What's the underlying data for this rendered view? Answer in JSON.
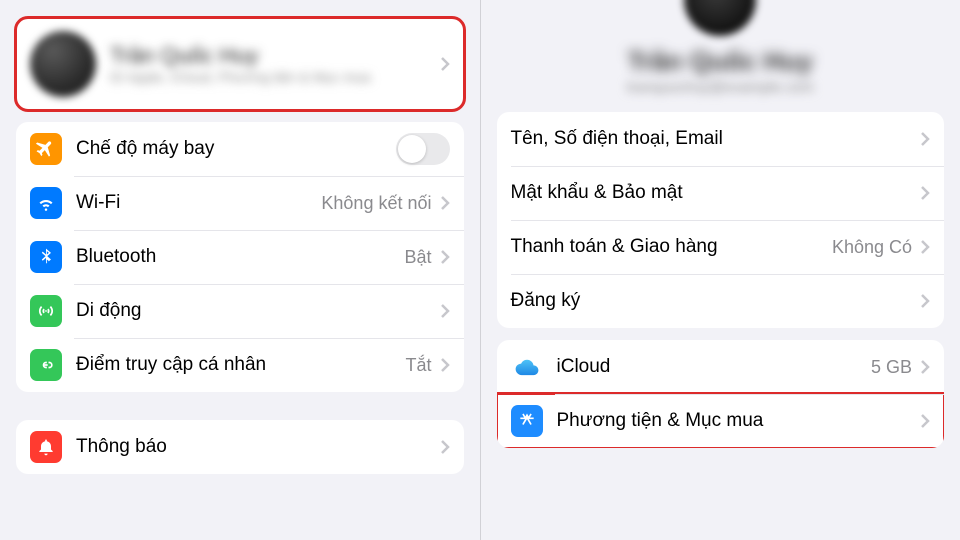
{
  "left": {
    "profile": {
      "name": "Trần Quốc Huy",
      "sub": "ID Apple, iCloud, Phương tiện & Mục mua"
    },
    "settings": [
      {
        "key": "airplane",
        "label": "Chế độ máy bay",
        "toggle": false,
        "icon": "airplane",
        "color": "#ff9500"
      },
      {
        "key": "wifi",
        "label": "Wi-Fi",
        "value": "Không kết nối",
        "icon": "wifi",
        "color": "#007aff"
      },
      {
        "key": "bluetooth",
        "label": "Bluetooth",
        "value": "Bật",
        "icon": "bluetooth",
        "color": "#007aff"
      },
      {
        "key": "cellular",
        "label": "Di động",
        "value": "",
        "icon": "antenna",
        "color": "#34c759"
      },
      {
        "key": "hotspot",
        "label": "Điểm truy cập cá nhân",
        "value": "Tắt",
        "icon": "link",
        "color": "#34c759"
      }
    ],
    "notifications": {
      "label": "Thông báo",
      "icon": "bell",
      "color": "#ff3b30"
    }
  },
  "right": {
    "profile": {
      "name": "Trần Quốc Huy",
      "sub": "tranquochuy@example.com"
    },
    "account": [
      {
        "key": "name_phone_email",
        "label": "Tên, Số điện thoại, Email"
      },
      {
        "key": "password",
        "label": "Mật khẩu & Bảo mật"
      },
      {
        "key": "payment",
        "label": "Thanh toán & Giao hàng",
        "value": "Không Có"
      },
      {
        "key": "subscriptions",
        "label": "Đăng ký"
      }
    ],
    "services": [
      {
        "key": "icloud",
        "label": "iCloud",
        "value": "5 GB",
        "icon": "cloud"
      },
      {
        "key": "media",
        "label": "Phương tiện & Mục mua",
        "icon": "appstore"
      }
    ]
  }
}
